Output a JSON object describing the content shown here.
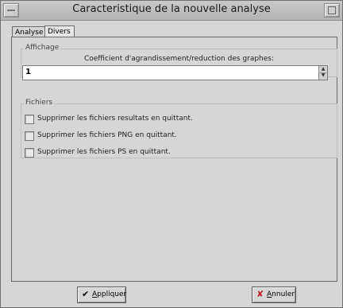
{
  "window": {
    "title": "Caracteristique de la nouvelle analyse"
  },
  "tabs": [
    {
      "label": "Analyse",
      "selected": false
    },
    {
      "label": "Divers",
      "selected": true
    }
  ],
  "affichage": {
    "group_title": "Affichage",
    "coeff_label": "Coefficient d'agrandissement/reduction des graphes:",
    "coeff_value": "1"
  },
  "fichiers": {
    "group_title": "Fichiers",
    "options": [
      {
        "label": "Supprimer les fichiers resultats en quittant.",
        "checked": false
      },
      {
        "label": "Supprimer les fichiers PNG en quittant.",
        "checked": false
      },
      {
        "label": "Supprimer les fichiers PS en quittant.",
        "checked": false
      }
    ]
  },
  "buttons": {
    "appliquer_first": "A",
    "appliquer_rest": "ppliquer",
    "annuler_first": "A",
    "annuler_rest": "nnuler"
  }
}
